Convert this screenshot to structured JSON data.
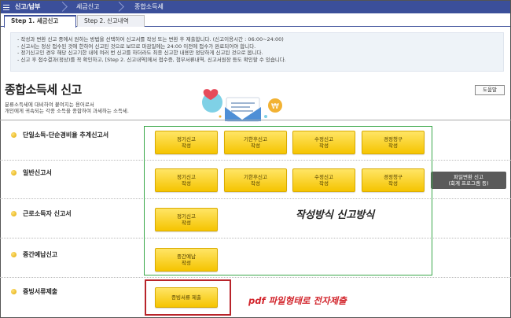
{
  "topbar": {
    "menu_icon": "hamburger-icon",
    "crumbs": [
      "신고/납부",
      "세금신고",
      "종합소득세"
    ]
  },
  "tabs": [
    "Step 1. 세금신고",
    "Step 2. 신고내역"
  ],
  "notice": [
    "작성과 변환 신고 중에서 원하는 방법을 선택하여 신고서를 작성 또는 변환 후 제출합니다. (신고이용시간 : 06:00~24:00)",
    "신고서는 정상 접수된 것에 한하여 신고된 것으로 보므로 마감일에는 24:00 이전에 접수가 완료되어야 합니다.",
    "정기신고인 경우 해당 신고기한 내에 여러 번 신고를 하더라도 최종 신고한 내용만 정당하게 신고된 것으로 봅니다.",
    "신고 후 접수결과(정상)를 꼭 확인하고, [Step 2. 신고내역]에서 접수증, 첨부서류내역, 신고서원장 등도 확인할 수 있습니다."
  ],
  "title": "종합소득세 신고",
  "description": [
    "분류소득세에 대비하여 붙여지는 용어로서",
    "개인에게 귀속되는 각종 소득을 종합하여 과세하는 소득세."
  ],
  "help_label": "도움말",
  "rows": [
    {
      "label": "단일소득-단순경비율 추계신고서",
      "buttons": [
        "정기신고\n작성",
        "기한후신고\n작성",
        "수정신고\n작성",
        "경정청구\n작성"
      ]
    },
    {
      "label": "일반신고서",
      "buttons": [
        "정기신고\n작성",
        "기한후신고\n작성",
        "수정신고\n작성",
        "경정청구\n작성"
      ],
      "extra_button": "파일변환 신고\n(회계 프로그램 등)"
    },
    {
      "label": "근로소득자 신고서",
      "buttons": [
        "정기신고\n작성"
      ]
    },
    {
      "label": "중간예납신고",
      "buttons": [
        "중간예납\n작성"
      ]
    },
    {
      "label": "증빙서류제출",
      "buttons": [
        "증빙서류 제출"
      ]
    }
  ],
  "annotations": {
    "method": "작성방식 신고방식",
    "pdf": "pdf 파일형태로 전자제출"
  },
  "colors": {
    "topbar": "#3b4f9a",
    "button_yellow": "#f5c400",
    "green_box": "#3aa84a",
    "red_box": "#b8242a",
    "pdf_text": "#d2252c"
  }
}
